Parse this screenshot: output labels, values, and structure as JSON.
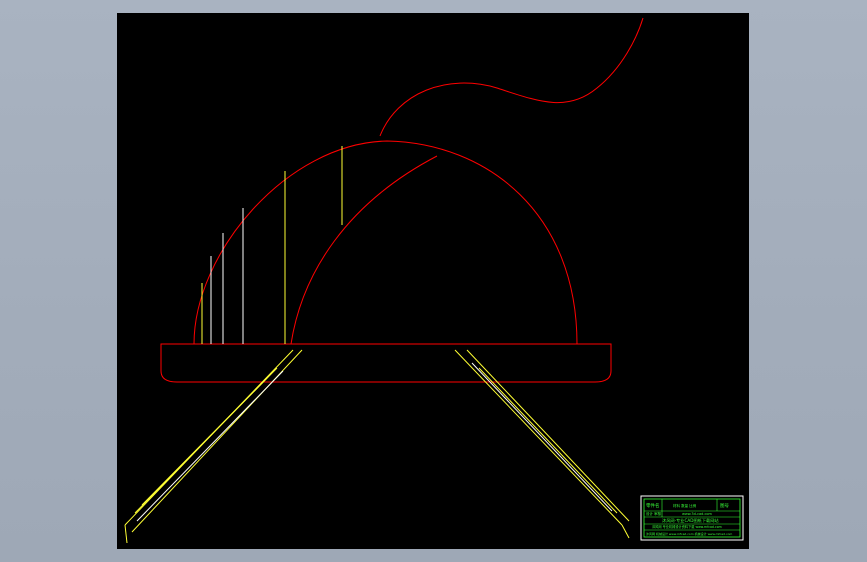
{
  "drawing": {
    "background": "#000000",
    "stroke_red": "#ff0000",
    "stroke_yellow": "#ffff33",
    "stroke_white": "#ffffff",
    "title_block_color": "#33ff33"
  },
  "title_block": {
    "row1_left": "零件名",
    "row1_mid": "材料 数量 比例",
    "row1_right": "图号",
    "row2_left": "设计 审核",
    "row2_mid": "www.3d-cad.com",
    "row3": "沐风网-专业CAD图纸下载网站",
    "row4": "沐风网 专业机械设计资料下载 www.mfcad.com",
    "row5": "沐风网 机械设计 www.mfcad.com 机械设计 www.mfcad.com"
  }
}
